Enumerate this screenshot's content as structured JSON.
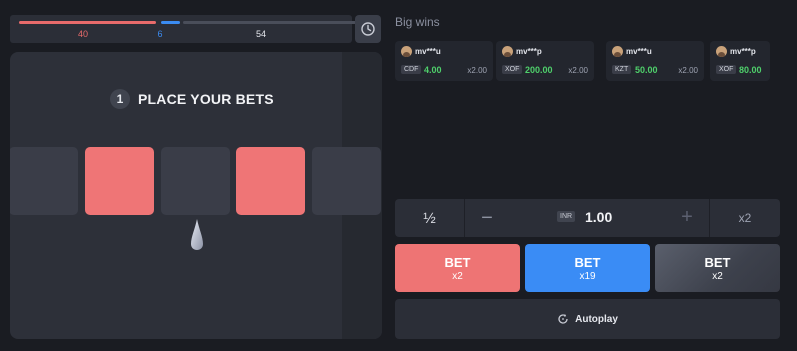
{
  "stats": {
    "red": "40",
    "blue": "6",
    "grey": "54"
  },
  "board": {
    "phase_number": "1",
    "phase_text": "PLACE YOUR BETS"
  },
  "big_wins": {
    "title": "Big wins",
    "items": [
      {
        "user": "mv***u",
        "currency": "CDF",
        "amount": "4.00",
        "multiplier": "x2.00"
      },
      {
        "user": "mv***p",
        "currency": "XOF",
        "amount": "200.00",
        "multiplier": "x2.00"
      },
      {
        "user": "mv***u",
        "currency": "KZT",
        "amount": "50.00",
        "multiplier": "x2.00"
      },
      {
        "user": "mv***p",
        "currency": "XOF",
        "amount": "80.00",
        "multiplier": ""
      }
    ]
  },
  "bet_input": {
    "half": "½",
    "minus": "−",
    "currency": "INR",
    "amount": "1.00",
    "plus": "+",
    "double": "x2"
  },
  "bet_buttons": [
    {
      "label": "BET",
      "multiplier": "x2",
      "color": "#ee7474"
    },
    {
      "label": "BET",
      "multiplier": "x19",
      "color": "#3a8cf5"
    },
    {
      "label": "BET",
      "multiplier": "x2",
      "color": "#4a4e5a"
    }
  ],
  "autoplay": {
    "label": "Autoplay"
  },
  "colors": {
    "red": "#ee7474",
    "blue": "#3a8cf5",
    "win_green": "#4fd06b",
    "background": "#1a1c22"
  }
}
